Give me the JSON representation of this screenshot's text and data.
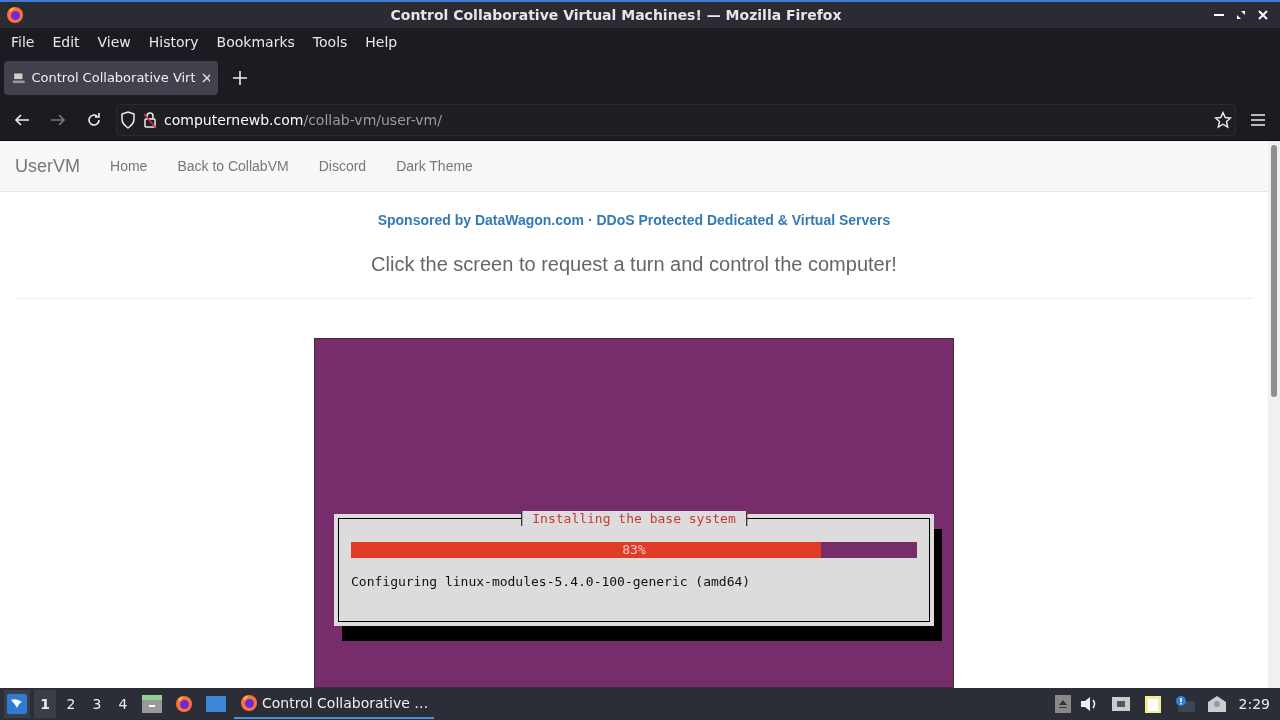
{
  "window": {
    "title": "Control Collaborative Virtual Machines! — Mozilla Firefox"
  },
  "menu": [
    "File",
    "Edit",
    "View",
    "History",
    "Bookmarks",
    "Tools",
    "Help"
  ],
  "tabs": [
    {
      "label": "Control Collaborative Virt",
      "selected": true
    }
  ],
  "address": {
    "host": "computernewb.com",
    "path": "/collab-vm/user-vm/"
  },
  "site_nav": {
    "brand": "UserVM",
    "links": [
      "Home",
      "Back to CollabVM",
      "Discord",
      "Dark Theme"
    ]
  },
  "sponsor": "Sponsored by DataWagon.com · DDoS Protected Dedicated & Virtual Servers",
  "heading": "Click the screen to request a turn and control the computer!",
  "vm_screen": {
    "dialog_title": "Installing the base system",
    "progress": {
      "level": 0.83,
      "reading": "83%"
    },
    "status": "Configuring linux-modules-5.4.0-100-generic (amd64)"
  },
  "taskbar": {
    "workspaces": [
      {
        "label": "1",
        "selected": true
      },
      {
        "label": "2",
        "selected": false
      },
      {
        "label": "3",
        "selected": false
      },
      {
        "label": "4",
        "selected": false
      }
    ],
    "tasks": [
      {
        "label": "Control Collaborative …",
        "selected": true
      }
    ],
    "clock": "2:29"
  }
}
